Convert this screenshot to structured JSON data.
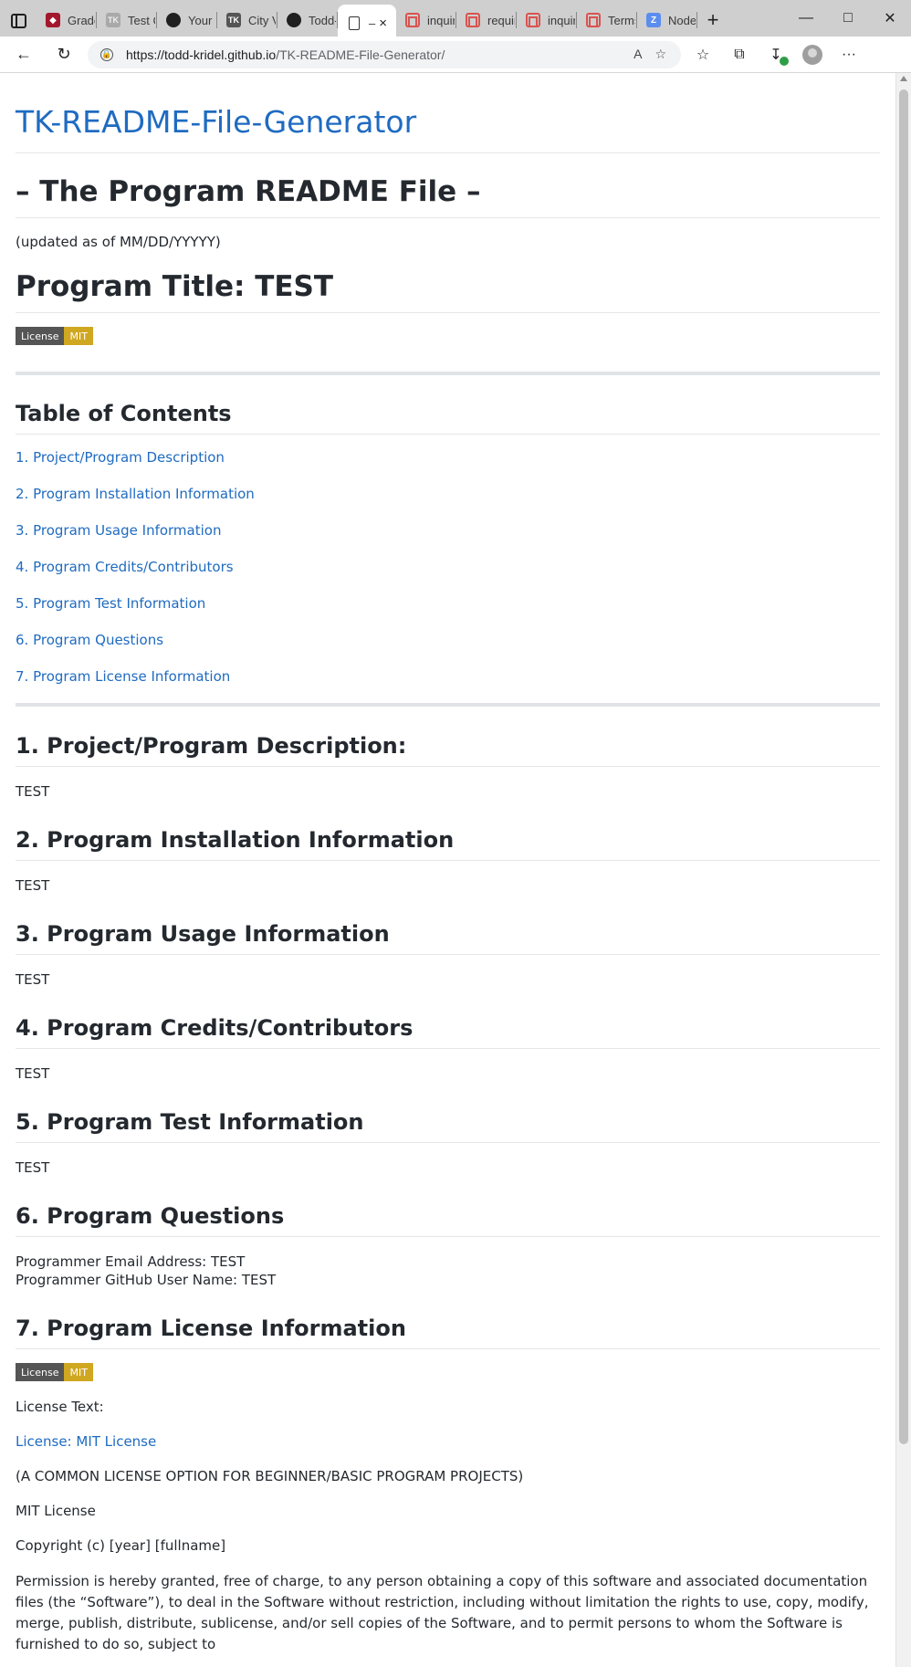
{
  "browser": {
    "tabs": [
      {
        "label": "Grade",
        "icon": "gradescope-icon"
      },
      {
        "label": "Test C",
        "icon": "tk-icon"
      },
      {
        "label": "Your I",
        "icon": "github-icon"
      },
      {
        "label": "City V",
        "icon": "tk-dark-icon"
      },
      {
        "label": "Todd-",
        "icon": "github-icon"
      },
      {
        "label": "–",
        "icon": "page-icon",
        "active": true
      },
      {
        "label": "inquir",
        "icon": "npm-icon"
      },
      {
        "label": "requir",
        "icon": "npm-icon"
      },
      {
        "label": "inquir",
        "icon": "npm-icon"
      },
      {
        "label": "Terms",
        "icon": "npm-icon"
      },
      {
        "label": "Node",
        "icon": "zoom-icon"
      }
    ],
    "active_tab_close": "×",
    "new_tab": "+",
    "url_host": "https://todd-kridel.github.io",
    "url_path": "/TK-README-File-Generator/",
    "read_aloud": "A",
    "more": "···"
  },
  "page": {
    "site_title": "TK-README-File-Generator",
    "readme_heading": "– The Program README File –",
    "updated": "(updated as of MM/DD/YYYYY)",
    "program_title": "Program Title: TEST",
    "badge": {
      "left": "License",
      "right": "MIT"
    },
    "toc_heading": "Table of Contents",
    "toc": [
      "1. Project/Program Description",
      "2. Program Installation Information",
      "3. Program Usage Information",
      "4. Program Credits/Contributors",
      "5. Program Test Information",
      "6. Program Questions",
      "7. Program License Information"
    ],
    "sections": {
      "s1": {
        "heading": "1. Project/Program Description:",
        "text": "TEST"
      },
      "s2": {
        "heading": "2. Program Installation Information",
        "text": "TEST"
      },
      "s3": {
        "heading": "3. Program Usage Information",
        "text": "TEST"
      },
      "s4": {
        "heading": "4. Program Credits/Contributors",
        "text": "TEST"
      },
      "s5": {
        "heading": "5. Program Test Information",
        "text": "TEST"
      },
      "s6": {
        "heading": "6. Program Questions",
        "email": "Programmer Email Address: TEST",
        "github": "Programmer GitHub User Name: TEST"
      },
      "s7": {
        "heading": "7. Program License Information",
        "license_text_label": "License Text:",
        "license_link": "License: MIT License",
        "common_note": "(A COMMON LICENSE OPTION FOR BEGINNER/BASIC PROGRAM PROJECTS)",
        "mit": "MIT License",
        "copyright": "Copyright (c) [year] [fullname]",
        "permission": "Permission is hereby granted, free of charge, to any person obtaining a copy of this software and associated documentation files (the “Software”), to deal in the Software without restriction, including without limitation the rights to use, copy, modify, merge, publish, distribute, sublicense, and/or sell copies of the Software, and to permit persons to whom the Software is furnished to do so, subject to"
      }
    }
  }
}
